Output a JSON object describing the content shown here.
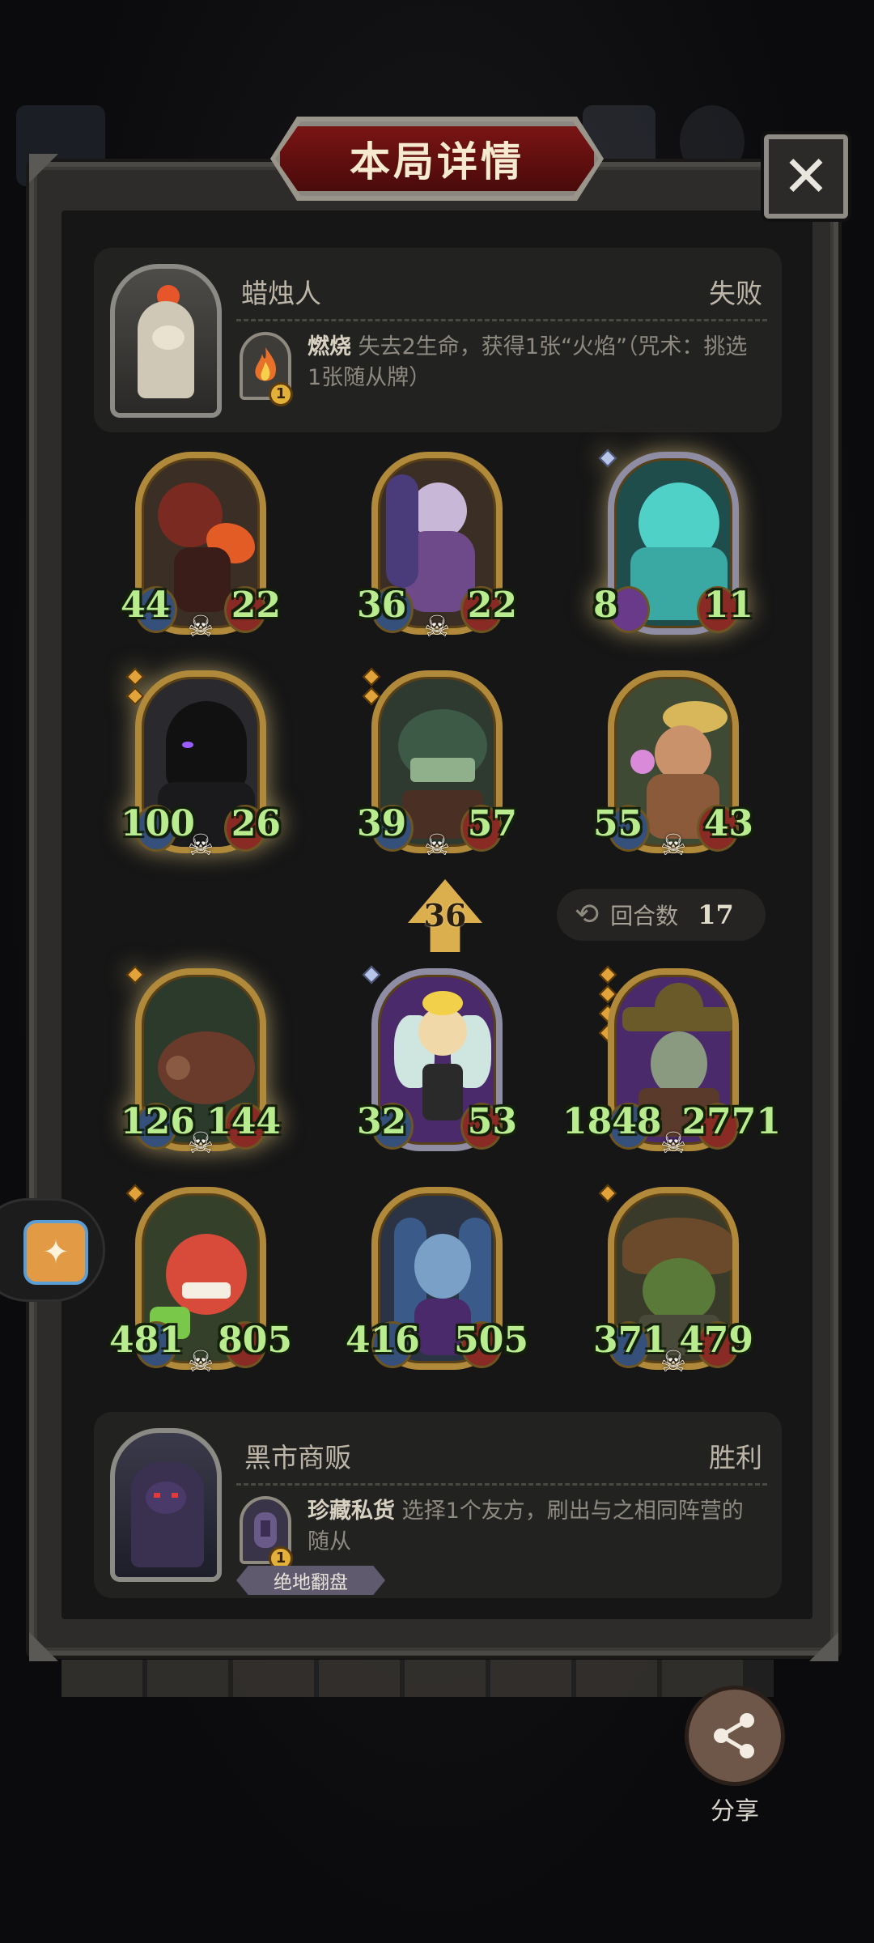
{
  "title": "本局详情",
  "close_icon": "close-icon",
  "opponent": {
    "name": "蜡烛人",
    "result": "失败",
    "power_name": "燃烧",
    "power_desc": "失去2生命，获得1张“火焰”（咒术：挑选1张随从牌）",
    "power_cost": "1"
  },
  "player": {
    "name": "黑市商贩",
    "result": "胜利",
    "power_name": "珍藏私货",
    "power_desc": "选择1个友方，刷出与之相同阵营的随从",
    "power_cost": "1",
    "tag": "绝地翻盘"
  },
  "opponent_board": [
    {
      "attack": "44",
      "health": "22"
    },
    {
      "attack": "36",
      "health": "22"
    },
    {
      "attack": "8",
      "health": "11"
    },
    {
      "attack": "100",
      "health": "26"
    },
    {
      "attack": "39",
      "health": "57"
    },
    {
      "attack": "55",
      "health": "43"
    }
  ],
  "tier": "36",
  "round": {
    "label": "回合数",
    "value": "17"
  },
  "player_board": [
    {
      "attack": "126",
      "health": "144"
    },
    {
      "attack": "32",
      "health": "53"
    },
    {
      "attack": "1848",
      "health": "2771"
    },
    {
      "attack": "481",
      "health": "805"
    },
    {
      "attack": "416",
      "health": "505"
    },
    {
      "attack": "371",
      "health": "479"
    }
  ],
  "share": {
    "label": "分享"
  },
  "colors": {
    "stat_text": "#b8ec8e",
    "frame_gold": "#b08a3a",
    "banner_red": "#7a1414"
  }
}
